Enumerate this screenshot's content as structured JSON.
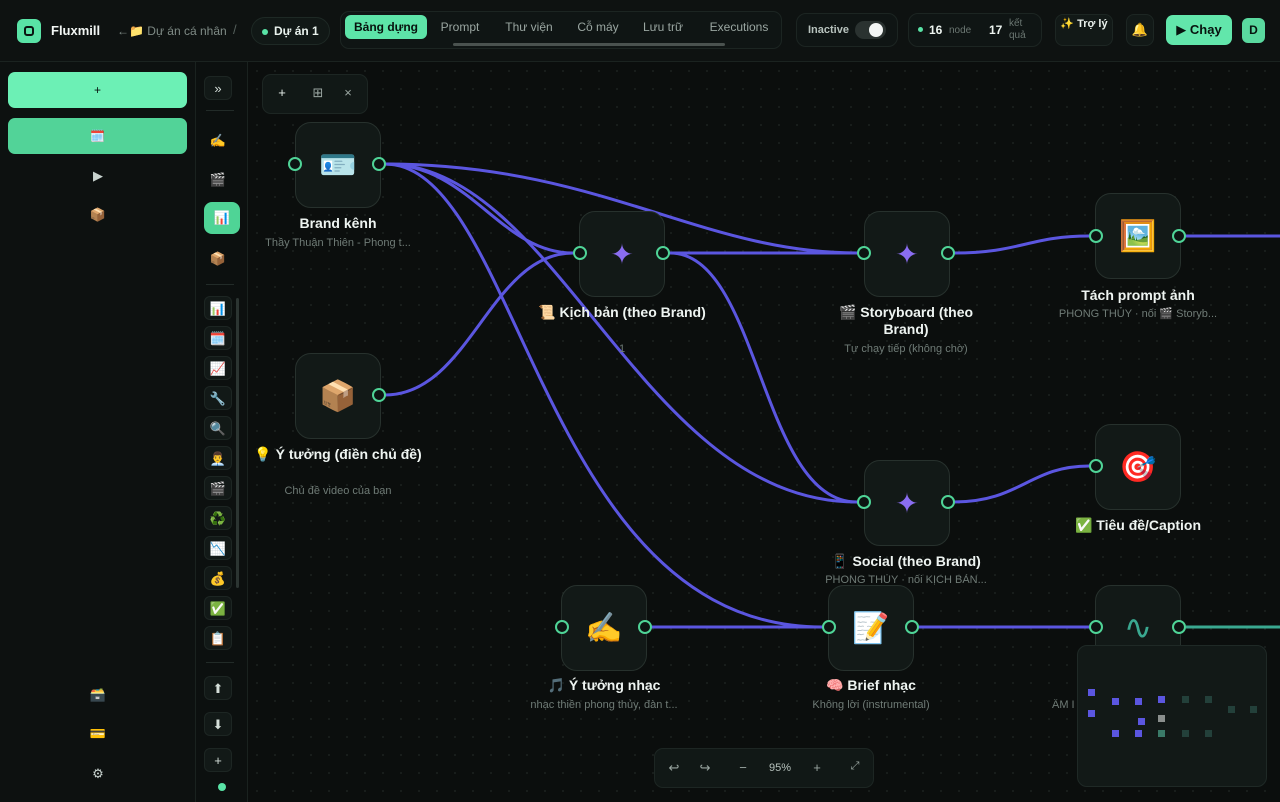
{
  "app": {
    "name": "Fluxmill"
  },
  "header": {
    "breadcrumb": "←📁 Dự án cá nhân",
    "breadcrumb_sep": "/",
    "project": "Dự án 1",
    "tabs": [
      "Bảng dựng",
      "Prompt",
      "Thư viện",
      "Cỗ máy",
      "Lưu trữ",
      "Executions"
    ],
    "status_label": "Inactive",
    "node_count": "16",
    "node_label": "node",
    "result_count": "17",
    "result_label": "kết quả",
    "assistant_label": "✨ Trợ lý",
    "notification_icon": "🔔",
    "run_label": "▶ Chạy",
    "avatar": "D"
  },
  "left_rail": {
    "add_label": "+",
    "folder_icon": "🗓️",
    "icons": [
      "▶",
      "📦"
    ],
    "bottom_icons": [
      "🗃️",
      "💳",
      "⚙"
    ]
  },
  "palette": {
    "collapse": "»",
    "top_items": [
      "✍️",
      "🎬",
      "📊",
      "📦"
    ],
    "items": [
      "📊",
      "🗓️",
      "📈",
      "🔧",
      "🔍",
      "👨‍💼",
      "🎬",
      "♻️",
      "📉",
      "💰",
      "✅",
      "📋"
    ],
    "bottom_items": [
      "⬆",
      "⬇",
      "+"
    ]
  },
  "canvas_tools": [
    "+",
    "⊞",
    "×"
  ],
  "nodes": [
    {
      "icon": "🪪",
      "label": "Brand kênh",
      "sub": "Thầy Thuận Thiên - Phong t..."
    },
    {
      "icon": "📦",
      "label": "💡 Ý tưởng (điền chủ đề)",
      "sub": "Chủ đề video của bạn"
    },
    {
      "icon": "✦",
      "label": "📜 Kịch bản (theo Brand)",
      "sub": "1"
    },
    {
      "icon": "✦",
      "label": "🎬 Storyboard (theo Brand)",
      "sub": "Tự chạy tiếp (không chờ)"
    },
    {
      "icon": "🖼️",
      "label": "Tách prompt ảnh",
      "sub": "PHONG THỦY · nối 🎬 Storyb..."
    },
    {
      "icon": "✦",
      "label": "📱 Social (theo Brand)",
      "sub": "PHONG THỦY · nối KỊCH BẢN..."
    },
    {
      "icon": "🎯",
      "label": "✅ Tiêu đề/Caption",
      "sub": ""
    },
    {
      "icon": "✍️",
      "label": "🎵 Ý tưởng nhạc",
      "sub": "nhạc thiền phong thủy, đàn t..."
    },
    {
      "icon": "📝",
      "label": "🧠 Brief nhạc",
      "sub": "Không lời (instrumental)"
    },
    {
      "icon": "∿",
      "label": "",
      "sub": "ÂM I"
    }
  ],
  "zoom": {
    "undo": "↩",
    "redo": "↪",
    "minus": "−",
    "value": "95%",
    "plus": "+",
    "fit": "⤢"
  },
  "colors": {
    "accent": "#59e3a6",
    "edge": "#5b56e0",
    "edge_green": "#3aa890",
    "sparkle": "#8a6df0"
  }
}
